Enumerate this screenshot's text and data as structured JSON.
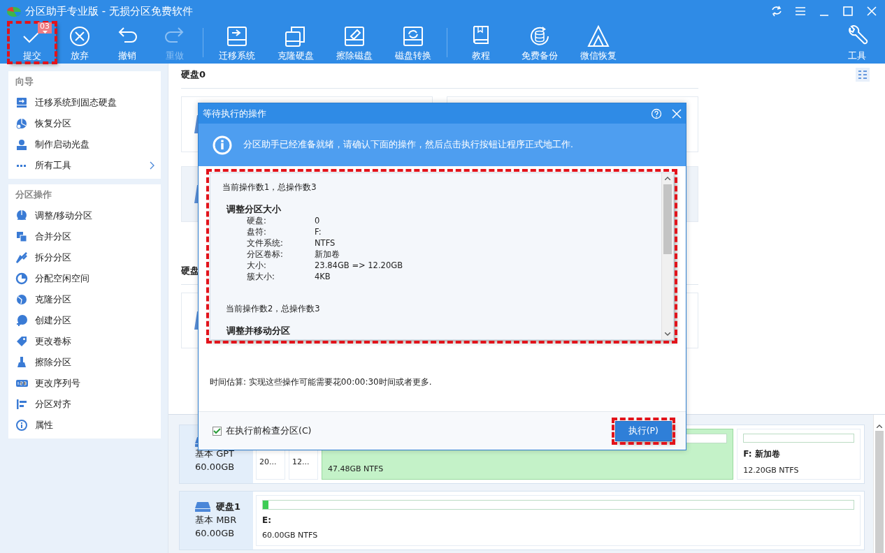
{
  "window": {
    "title": "分区助手专业版 - 无损分区免费软件"
  },
  "toolbar": {
    "groups": [
      {
        "buttons": [
          {
            "kind": "check",
            "label": "提交",
            "badge": "03",
            "disabled": false,
            "highlighted": true
          },
          {
            "kind": "cancel",
            "label": "放弃",
            "disabled": false,
            "highlighted": false
          },
          {
            "kind": "undo",
            "label": "撤销",
            "disabled": false,
            "highlighted": false
          },
          {
            "kind": "redo",
            "label": "重做",
            "disabled": true,
            "highlighted": false
          }
        ]
      },
      {
        "buttons": [
          {
            "kind": "migrate",
            "label": "迁移系统",
            "disabled": false,
            "highlighted": false
          },
          {
            "kind": "clone",
            "label": "克隆硬盘",
            "disabled": false,
            "highlighted": false
          },
          {
            "kind": "wipe",
            "label": "擦除磁盘",
            "disabled": false,
            "highlighted": false
          },
          {
            "kind": "convert",
            "label": "磁盘转换",
            "disabled": false,
            "highlighted": false
          }
        ]
      },
      {
        "buttons": [
          {
            "kind": "book",
            "label": "教程",
            "disabled": false,
            "highlighted": false
          },
          {
            "kind": "backup",
            "label": "免费备份",
            "disabled": false,
            "highlighted": false
          },
          {
            "kind": "wechat",
            "label": "微信恢复",
            "disabled": false,
            "highlighted": false
          }
        ]
      }
    ],
    "end_button": {
      "kind": "tools",
      "label": "工具",
      "disabled": false,
      "highlighted": false
    }
  },
  "sidebar": {
    "sections": [
      {
        "title": "向导",
        "items": [
          {
            "kind": "migrate",
            "label": "迁移系统到固态硬盘",
            "submenu": false
          },
          {
            "kind": "recover",
            "label": "恢复分区",
            "submenu": false
          },
          {
            "kind": "bootdisk",
            "label": "制作启动光盘",
            "submenu": false
          },
          {
            "kind": "more",
            "label": "所有工具",
            "submenu": true
          }
        ]
      },
      {
        "title": "分区操作",
        "items": [
          {
            "kind": "resize",
            "label": "调整/移动分区",
            "submenu": false
          },
          {
            "kind": "merge",
            "label": "合并分区",
            "submenu": false
          },
          {
            "kind": "split",
            "label": "拆分分区",
            "submenu": false
          },
          {
            "kind": "allocate",
            "label": "分配空闲空间",
            "submenu": false
          },
          {
            "kind": "clone",
            "label": "克隆分区",
            "submenu": false
          },
          {
            "kind": "create",
            "label": "创建分区",
            "submenu": false
          },
          {
            "kind": "label",
            "label": "更改卷标",
            "submenu": false
          },
          {
            "kind": "wipe",
            "label": "擦除分区",
            "submenu": false
          },
          {
            "kind": "serial",
            "label": "更改序列号",
            "submenu": false
          },
          {
            "kind": "align",
            "label": "分区对齐",
            "submenu": false
          },
          {
            "kind": "info",
            "label": "属性",
            "submenu": false
          }
        ]
      }
    ]
  },
  "disk_view": {
    "titles": [
      "硬盘0",
      "硬盘"
    ]
  },
  "dialog": {
    "title": "等待执行的操作",
    "info": "分区助手已经准备就绪，请确认下面的操作，然后点击执行按钮让程序正式地工作.",
    "highlighted": true,
    "operations": [
      {
        "header": "当前操作数1，总操作数3",
        "title": "调整分区大小",
        "fields": [
          {
            "label": "硬盘:",
            "value": "0"
          },
          {
            "label": "盘符:",
            "value": "F:"
          },
          {
            "label": "文件系统:",
            "value": "NTFS"
          },
          {
            "label": "分区卷标:",
            "value": "新加卷"
          },
          {
            "label": "大小:",
            "value": "23.84GB => 12.20GB"
          },
          {
            "label": "簇大小:",
            "value": "4KB"
          }
        ]
      },
      {
        "header": "当前操作数2，总操作数3",
        "title": "调整并移动分区"
      }
    ],
    "estimate": "时间估算: 实现这些操作可能需要花00:00:30时间或者更多.",
    "check_option": {
      "label": "在执行前检查分区(C)",
      "checked": true
    },
    "execute_button": {
      "label": "执行(P)",
      "highlighted": true
    }
  },
  "disk_map": {
    "disks": [
      {
        "type": "基本 GPT",
        "size": "60.00GB",
        "partitions": [
          {
            "kind": "small",
            "label": "20...",
            "selected": false
          },
          {
            "kind": "small",
            "label": "12...",
            "selected": false
          },
          {
            "kind": "volume",
            "size": "47.48GB NTFS",
            "selected": true
          },
          {
            "kind": "volume",
            "name": "F: 新加卷",
            "size": "12.20GB NTFS",
            "selected": false
          }
        ]
      },
      {
        "name": "硬盘1",
        "type": "基本 MBR",
        "size": "60.00GB",
        "partitions": [
          {
            "kind": "volume",
            "name": "E:",
            "size": "60.00GB NTFS",
            "selected": false,
            "level": 0.01
          }
        ]
      }
    ]
  }
}
